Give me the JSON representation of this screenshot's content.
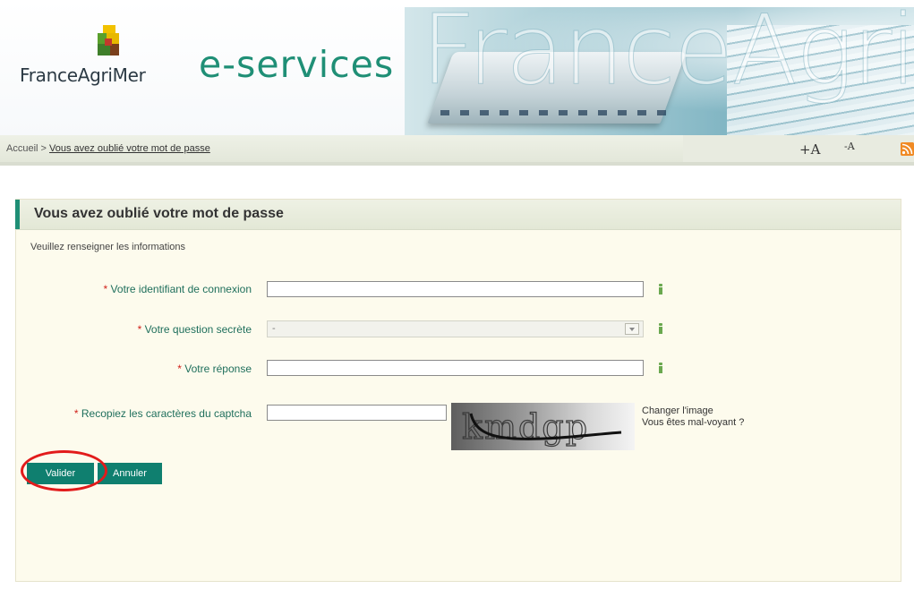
{
  "header": {
    "logo_text": "FranceAgriMer",
    "service_title": "e-services",
    "watermark_text": "FranceAgriMer"
  },
  "breadcrumb": {
    "home": "Accueil",
    "separator": ">",
    "current": "Vous avez oublié votre mot de passe"
  },
  "tools": {
    "font_increase": "+A",
    "font_decrease": "-A"
  },
  "page": {
    "title": "Vous avez oublié votre mot de passe",
    "intro": "Veuillez renseigner les informations"
  },
  "form": {
    "required_marker": "*",
    "login_label": "Votre identifiant de connexion",
    "login_value": "",
    "question_label": "Votre question secrète",
    "question_value": "-",
    "answer_label": "Votre réponse",
    "answer_value": "",
    "captcha_label": "Recopiez les caractères du captcha",
    "captcha_value": "",
    "captcha_text": "kmdgp",
    "change_image": "Changer l'image",
    "visually_impaired": "Vous êtes mal-voyant ?"
  },
  "actions": {
    "validate": "Valider",
    "cancel": "Annuler"
  },
  "colors": {
    "brand_green": "#1f8f76",
    "button_green": "#0f7f6f",
    "required_red": "#d0211a",
    "highlight_red": "#e21b1b",
    "panel_background": "#fdfbed",
    "rss_orange": "#f08a24"
  },
  "icons": [
    "franceagrimer-logo-icon",
    "rss-icon",
    "info-icon",
    "dropdown-arrow-icon"
  ]
}
